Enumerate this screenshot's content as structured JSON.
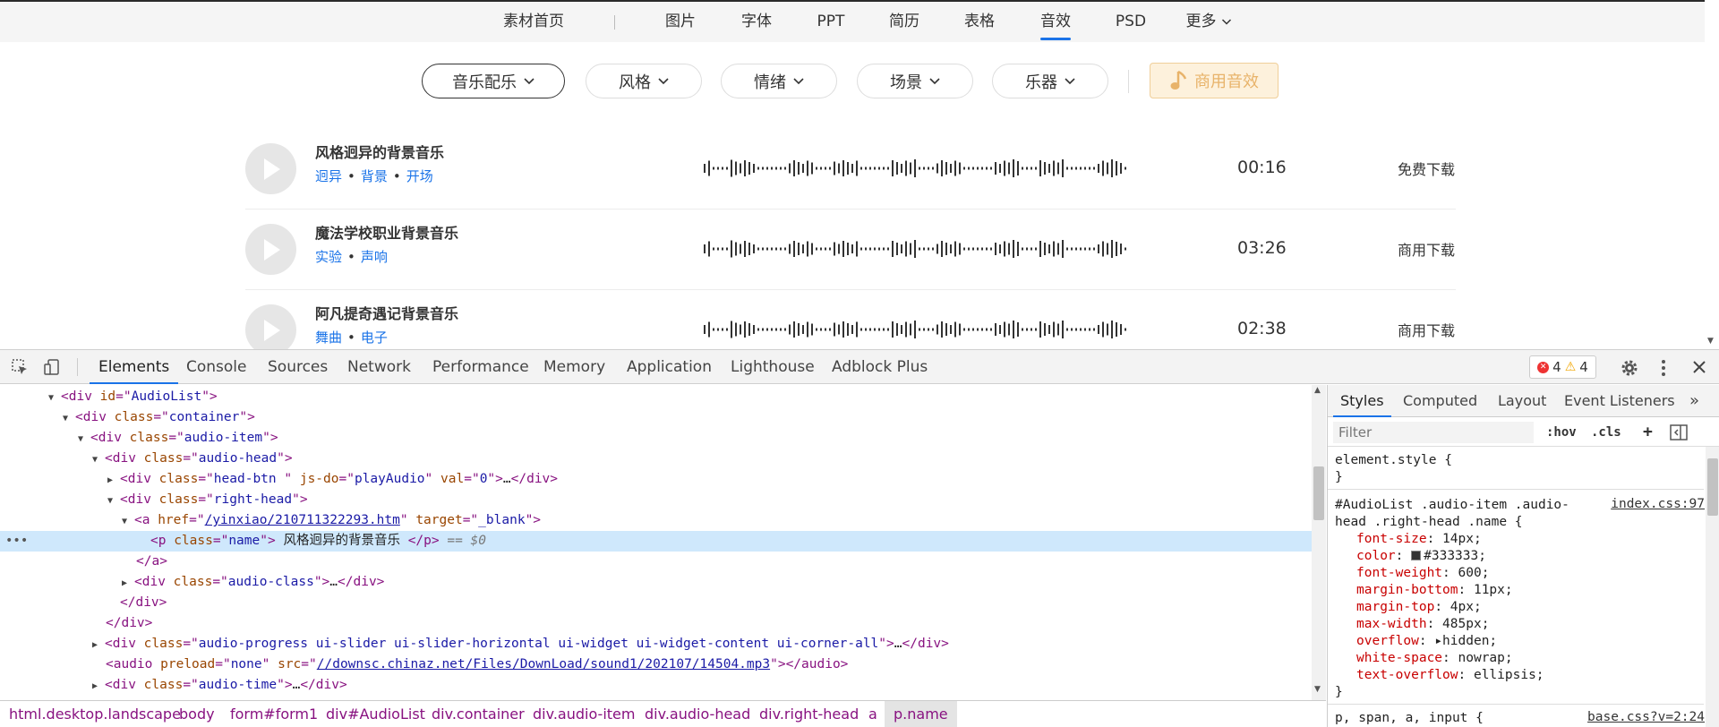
{
  "nav": {
    "home": "素材首页",
    "items": [
      "图片",
      "字体",
      "PPT",
      "简历",
      "表格",
      "音效",
      "PSD",
      "更多"
    ],
    "active_index": 5
  },
  "filters": {
    "buttons": [
      "音乐配乐",
      "风格",
      "情绪",
      "场景",
      "乐器"
    ],
    "selected_index": 0,
    "commercial": "商用音效"
  },
  "audio_list": [
    {
      "name": "风格迥异的背景音乐",
      "tags": [
        "迥异",
        "背景",
        "开场"
      ],
      "duration": "00:16",
      "download": "免费下载"
    },
    {
      "name": "魔法学校职业背景音乐",
      "tags": [
        "实验",
        "声响"
      ],
      "duration": "03:26",
      "download": "商用下载"
    },
    {
      "name": "阿凡提奇遇记背景音乐",
      "tags": [
        "舞曲",
        "电子"
      ],
      "duration": "02:38",
      "download": "商用下载"
    }
  ],
  "devtools": {
    "tabs": [
      "Elements",
      "Console",
      "Sources",
      "Network",
      "Performance",
      "Memory",
      "Application",
      "Lighthouse",
      "Adblock Plus"
    ],
    "active_tab": "Elements",
    "errors": "4",
    "warnings": "4",
    "code": {
      "l0_tag": "div",
      "l0_attr": "id",
      "l0_val": "AudioList",
      "l1_tag": "div",
      "l1_attr": "class",
      "l1_val": "container",
      "l2_tag": "div",
      "l2_attr": "class",
      "l2_val": "audio-item",
      "l3_tag": "div",
      "l3_attr": "class",
      "l3_val": "audio-head",
      "l4_tag": "div",
      "l4_attr1": "class",
      "l4_val1": "head-btn ",
      "l4_attr2": "js-do",
      "l4_val2": "playAudio",
      "l4_attr3": "val",
      "l4_val3": "0",
      "l5_tag": "div",
      "l5_attr": "class",
      "l5_val": "right-head",
      "l6_tag": "a",
      "l6_attr1": "href",
      "l6_val1": "/yinxiao/210711322293.htm",
      "l6_attr2": "target",
      "l6_val2": "_blank",
      "l7_tag": "p",
      "l7_attr": "class",
      "l7_val": "name",
      "l7_text": " 风格迥异的背景音乐 ",
      "l7_eq": "== $0",
      "l8_close": "</a>",
      "l9_tag": "div",
      "l9_attr": "class",
      "l9_val": "audio-class",
      "l10_close": "</div>",
      "l11_close": "</div>",
      "l12_tag": "div",
      "l12_attr": "class",
      "l12_val": "audio-progress ui-slider ui-slider-horizontal ui-widget ui-widget-content ui-corner-all",
      "l13_tag": "audio",
      "l13_attr1": "preload",
      "l13_val1": "none",
      "l13_attr2": "src",
      "l13_val2": "//downsc.chinaz.net/Files/DownLoad/sound1/202107/14504.mp3",
      "l14_tag": "div",
      "l14_attr": "class",
      "l14_val": "audio-time",
      "ellipsis": "…",
      "close_div": "</div>",
      "close_audio": "</audio>"
    },
    "breadcrumbs": [
      "html.desktop.landscape",
      "body",
      "form#form1",
      "div#AudioList",
      "div.container",
      "div.audio-item",
      "div.audio-head",
      "div.right-head",
      "a",
      "p.name"
    ],
    "styles_tabs": [
      "Styles",
      "Computed",
      "Layout",
      "Event Listeners"
    ],
    "filter_placeholder": "Filter",
    "filter_tools": [
      ":hov",
      ".cls",
      "+"
    ],
    "css": {
      "element_style": "element.style {",
      "close": "}",
      "selector_1": "#AudioList .audio-item .audio-",
      "selector_2": "head .right-head .name {",
      "source": "index.css:97",
      "props": [
        {
          "name": "font-size",
          "value": "14px;"
        },
        {
          "name": "color",
          "value": "#333333;"
        },
        {
          "name": "font-weight",
          "value": "600;"
        },
        {
          "name": "margin-bottom",
          "value": "11px;"
        },
        {
          "name": "margin-top",
          "value": "4px;"
        },
        {
          "name": "max-width",
          "value": "485px;"
        },
        {
          "name": "overflow",
          "value": "hidden;"
        },
        {
          "name": "white-space",
          "value": "nowrap;"
        },
        {
          "name": "text-overflow",
          "value": "ellipsis;"
        }
      ],
      "next_selector": "p, span, a, input {",
      "next_source": "base.css?v=2:24"
    }
  },
  "colors": {
    "accent": "#1a73e8",
    "commercial_bg": "#fdf1dc",
    "commercial_text": "#e8b36a",
    "tag_link": "#1a73e8"
  }
}
